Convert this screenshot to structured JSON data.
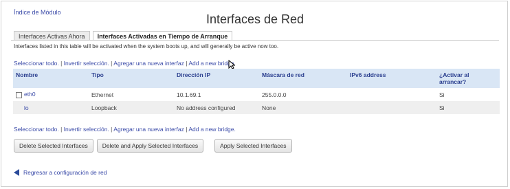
{
  "module_index": "Índice de Módulo",
  "title": "Interfaces de Red",
  "tabs": [
    {
      "label": "Interfaces Activas Ahora"
    },
    {
      "label": "Interfaces Activadas en Tiempo de Arranque"
    }
  ],
  "description": "Interfaces listed in this table will be activated when the system boots up, and will generally be active now too.",
  "links": {
    "select_all": "Seleccionar todo.",
    "invert": "Invertir selección.",
    "add_iface": "Agregar una nueva interfaz",
    "add_bridge": "Add a new bridge.",
    "sep": "|"
  },
  "table": {
    "headers": {
      "name": "Nombre",
      "type": "Tipo",
      "ip": "Dirección IP",
      "mask": "Máscara de red",
      "ipv6": "IPv6 address",
      "boot": "¿Activar al arrancar?"
    },
    "rows": [
      {
        "name": "eth0",
        "type": "Ethernet",
        "ip": "10.1.69.1",
        "mask": "255.0.0.0",
        "ipv6": "",
        "boot": "Si"
      },
      {
        "name": "lo",
        "type": "Loopback",
        "ip": "No address configured",
        "mask": "None",
        "ipv6": "",
        "boot": "Si"
      }
    ]
  },
  "buttons": {
    "delete": "Delete Selected Interfaces",
    "delete_apply": "Delete and Apply Selected Interfaces",
    "apply": "Apply Selected Interfaces"
  },
  "back_link": "Regresar a configuración de red"
}
